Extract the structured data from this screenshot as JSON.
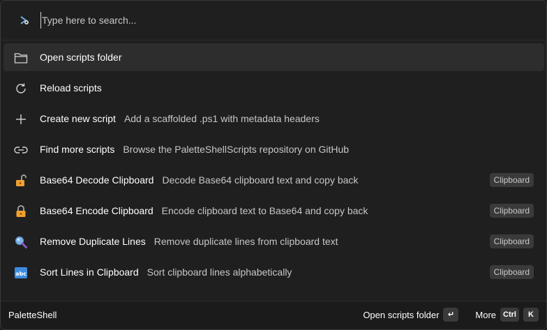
{
  "search": {
    "placeholder": "Type here to search..."
  },
  "items": [
    {
      "title": "Open scripts folder",
      "description": "",
      "icon": "folder-icon",
      "tag": "",
      "selected": true
    },
    {
      "title": "Reload scripts",
      "description": "",
      "icon": "refresh-icon",
      "tag": ""
    },
    {
      "title": "Create new script",
      "description": "Add a scaffolded .ps1 with metadata headers",
      "icon": "plus-icon",
      "tag": ""
    },
    {
      "title": "Find more scripts",
      "description": "Browse the PaletteShellScripts repository on GitHub",
      "icon": "link-icon",
      "tag": ""
    },
    {
      "title": "Base64 Decode Clipboard",
      "description": "Decode Base64 clipboard text and copy back",
      "icon": "unlock-icon",
      "tag": "Clipboard"
    },
    {
      "title": "Base64 Encode Clipboard",
      "description": "Encode clipboard text to Base64 and copy back",
      "icon": "lock-icon",
      "tag": "Clipboard"
    },
    {
      "title": "Remove Duplicate Lines",
      "description": "Remove duplicate lines from clipboard text",
      "icon": "magnifier-icon",
      "tag": "Clipboard"
    },
    {
      "title": "Sort Lines in Clipboard",
      "description": "Sort clipboard lines alphabetically",
      "icon": "abc-icon",
      "tag": "Clipboard"
    }
  ],
  "footer": {
    "app_name": "PaletteShell",
    "primary_action": "Open scripts folder",
    "primary_key": "↵",
    "more_label": "More",
    "more_key_1": "Ctrl",
    "more_key_2": "K"
  },
  "colors": {
    "background": "#1f1f1f",
    "selected_row": "#2d2d2d",
    "tag_bg": "#3a3a3a",
    "lock_orange": "#f0a030"
  }
}
